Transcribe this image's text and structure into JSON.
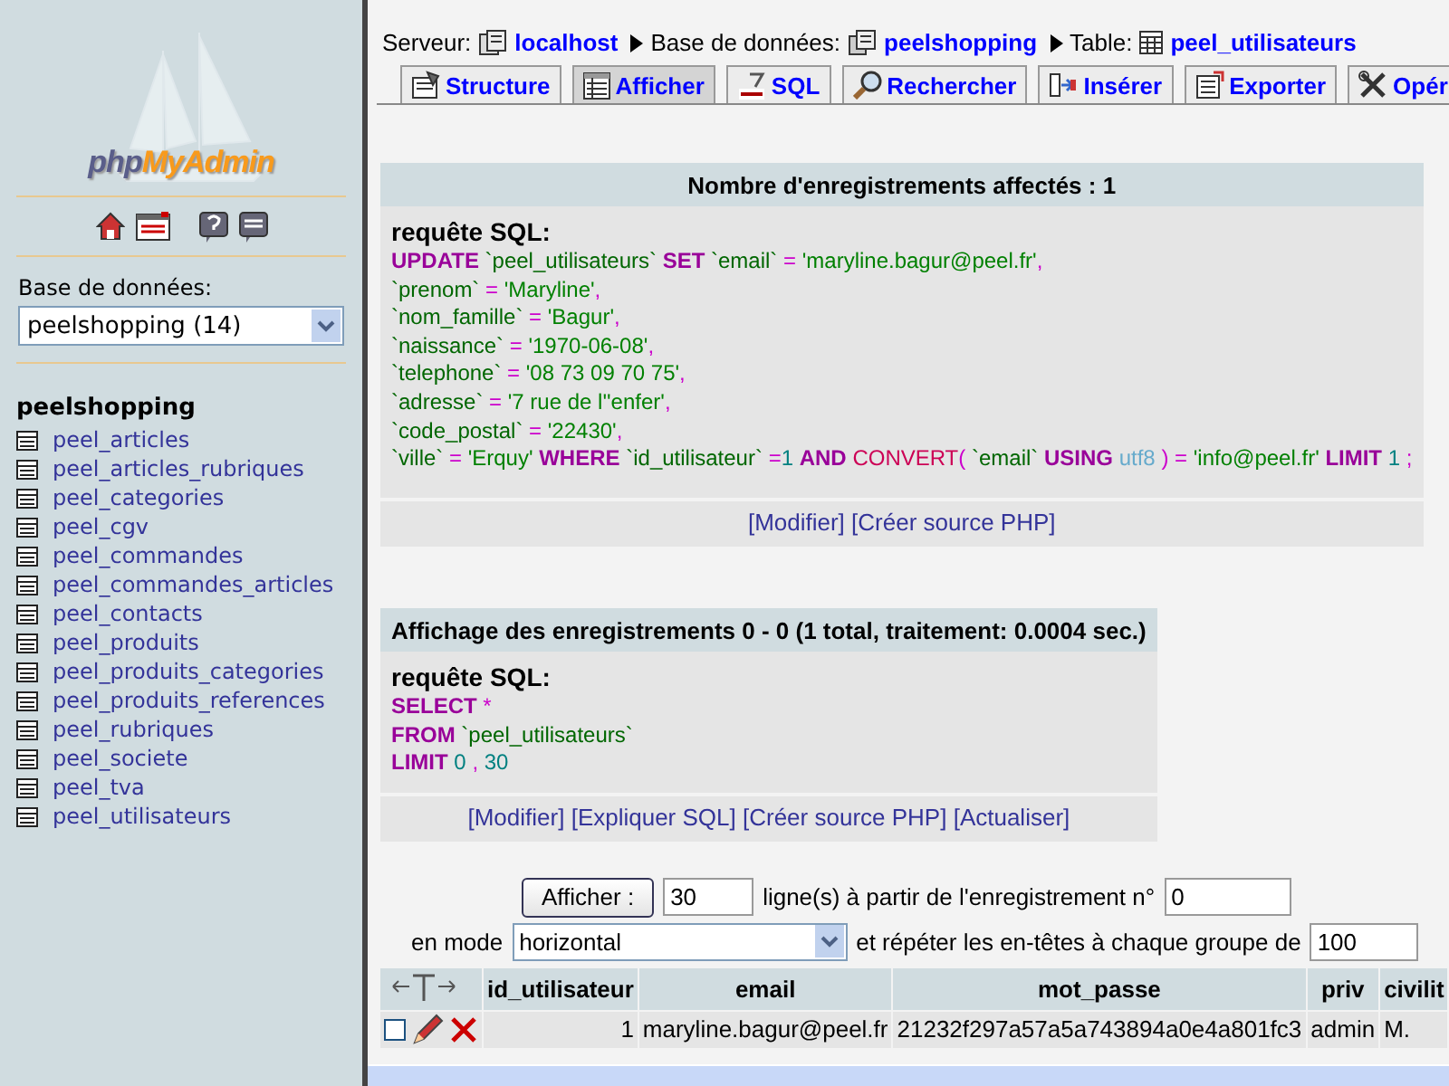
{
  "sidebar": {
    "logo": [
      "php",
      "MyAdmin"
    ],
    "db_label": "Base de données:",
    "db_select": "peelshopping (14)",
    "db_name": "peelshopping",
    "tables": [
      "peel_articles",
      "peel_articles_rubriques",
      "peel_categories",
      "peel_cgv",
      "peel_commandes",
      "peel_commandes_articles",
      "peel_contacts",
      "peel_produits",
      "peel_produits_categories",
      "peel_produits_references",
      "peel_rubriques",
      "peel_societe",
      "peel_tva",
      "peel_utilisateurs"
    ]
  },
  "breadcrumb": [
    {
      "label": "Serveur:",
      "link": "localhost"
    },
    {
      "label": "Base de données:",
      "link": "peelshopping"
    },
    {
      "label": "Table:",
      "link": "peel_utilisateurs"
    }
  ],
  "tabs": [
    {
      "label": "Structure",
      "selected": false
    },
    {
      "label": "Afficher",
      "selected": true
    },
    {
      "label": "SQL",
      "selected": false
    },
    {
      "label": "Rechercher",
      "selected": false
    },
    {
      "label": "Insérer",
      "selected": false
    },
    {
      "label": "Exporter",
      "selected": false
    },
    {
      "label": "Opér",
      "selected": false
    }
  ],
  "result_boxes": [
    {
      "title": "Nombre d'enregistrements affectés : 1",
      "sql_label": "requête SQL:",
      "sql_lines": [
        [
          {
            "kind": "keyword",
            "text": "UPDATE "
          },
          {
            "kind": "identifier",
            "text": "`peel_utilisateurs` "
          },
          {
            "kind": "keyword",
            "text": "SET "
          },
          {
            "kind": "identifier",
            "text": "`email` "
          },
          {
            "kind": "operator",
            "text": "= "
          },
          {
            "kind": "string",
            "text": "'maryline.bagur@peel.fr'"
          },
          {
            "kind": "punct",
            "text": ","
          }
        ],
        [
          {
            "kind": "identifier",
            "text": "`prenom` "
          },
          {
            "kind": "operator",
            "text": "= "
          },
          {
            "kind": "string",
            "text": "'Maryline'"
          },
          {
            "kind": "punct",
            "text": ","
          }
        ],
        [
          {
            "kind": "identifier",
            "text": "`nom_famille` "
          },
          {
            "kind": "operator",
            "text": "= "
          },
          {
            "kind": "string",
            "text": "'Bagur'"
          },
          {
            "kind": "punct",
            "text": ","
          }
        ],
        [
          {
            "kind": "identifier",
            "text": "`naissance` "
          },
          {
            "kind": "operator",
            "text": "= "
          },
          {
            "kind": "string",
            "text": "'1970-06-08'"
          },
          {
            "kind": "punct",
            "text": ","
          }
        ],
        [
          {
            "kind": "identifier",
            "text": "`telephone` "
          },
          {
            "kind": "operator",
            "text": "= "
          },
          {
            "kind": "string",
            "text": "'08 73 09 70 75'"
          },
          {
            "kind": "punct",
            "text": ","
          }
        ],
        [
          {
            "kind": "identifier",
            "text": "`adresse` "
          },
          {
            "kind": "operator",
            "text": "= "
          },
          {
            "kind": "string",
            "text": "'7 rue de l''enfer'"
          },
          {
            "kind": "punct",
            "text": ","
          }
        ],
        [
          {
            "kind": "identifier",
            "text": "`code_postal` "
          },
          {
            "kind": "operator",
            "text": "= "
          },
          {
            "kind": "string",
            "text": "'22430'"
          },
          {
            "kind": "punct",
            "text": ","
          }
        ],
        [
          {
            "kind": "identifier",
            "text": "`ville` "
          },
          {
            "kind": "operator",
            "text": "= "
          },
          {
            "kind": "string",
            "text": "'Erquy' "
          },
          {
            "kind": "keyword",
            "text": "WHERE "
          },
          {
            "kind": "identifier",
            "text": "`id_utilisateur` "
          },
          {
            "kind": "operator",
            "text": "="
          },
          {
            "kind": "number",
            "text": "1 "
          },
          {
            "kind": "keyword",
            "text": "AND "
          },
          {
            "kind": "function",
            "text": "CONVERT"
          },
          {
            "kind": "punct",
            "text": "( "
          },
          {
            "kind": "identifier",
            "text": "`email` "
          },
          {
            "kind": "keyword",
            "text": "USING "
          },
          {
            "kind": "charset",
            "text": "utf8 "
          },
          {
            "kind": "punct",
            "text": ") "
          },
          {
            "kind": "operator",
            "text": "= "
          },
          {
            "kind": "string",
            "text": "'info@peel.fr' "
          },
          {
            "kind": "keyword",
            "text": "LIMIT "
          },
          {
            "kind": "number",
            "text": "1 "
          },
          {
            "kind": "punct",
            "text": ";"
          }
        ]
      ],
      "links": [
        "[Modifier]",
        "[Créer source PHP]"
      ]
    },
    {
      "title": "Affichage des enregistrements 0 - 0 (1 total, traitement: 0.0004 sec.)",
      "sql_label": "requête SQL:",
      "sql_lines": [
        [
          {
            "kind": "keyword",
            "text": "SELECT "
          },
          {
            "kind": "punct",
            "text": "*"
          }
        ],
        [
          {
            "kind": "keyword",
            "text": "FROM "
          },
          {
            "kind": "identifier",
            "text": "`peel_utilisateurs`"
          }
        ],
        [
          {
            "kind": "keyword",
            "text": "LIMIT "
          },
          {
            "kind": "number",
            "text": "0 "
          },
          {
            "kind": "punct",
            "text": ", "
          },
          {
            "kind": "number",
            "text": "30"
          }
        ]
      ],
      "links": [
        "[Modifier]",
        "[Expliquer SQL]",
        "[Créer source PHP]",
        "[Actualiser]"
      ]
    }
  ],
  "display_form": {
    "button": "Afficher :",
    "rows_value": "30",
    "rows_text": "ligne(s) à partir de l'enregistrement n°",
    "start_value": "0",
    "mode_label": "en mode",
    "mode_value": "horizontal",
    "repeat_text": "et répéter les en-têtes à chaque groupe de",
    "repeat_value": "100"
  },
  "table": {
    "columns": [
      "id_utilisateur",
      "email",
      "mot_passe",
      "priv",
      "civilit"
    ],
    "rows": [
      {
        "checked": false,
        "cells": [
          "1",
          "maryline.bagur@peel.fr",
          "21232f297a57a5a743894a0e4a801fc3",
          "admin",
          "M."
        ]
      }
    ]
  }
}
